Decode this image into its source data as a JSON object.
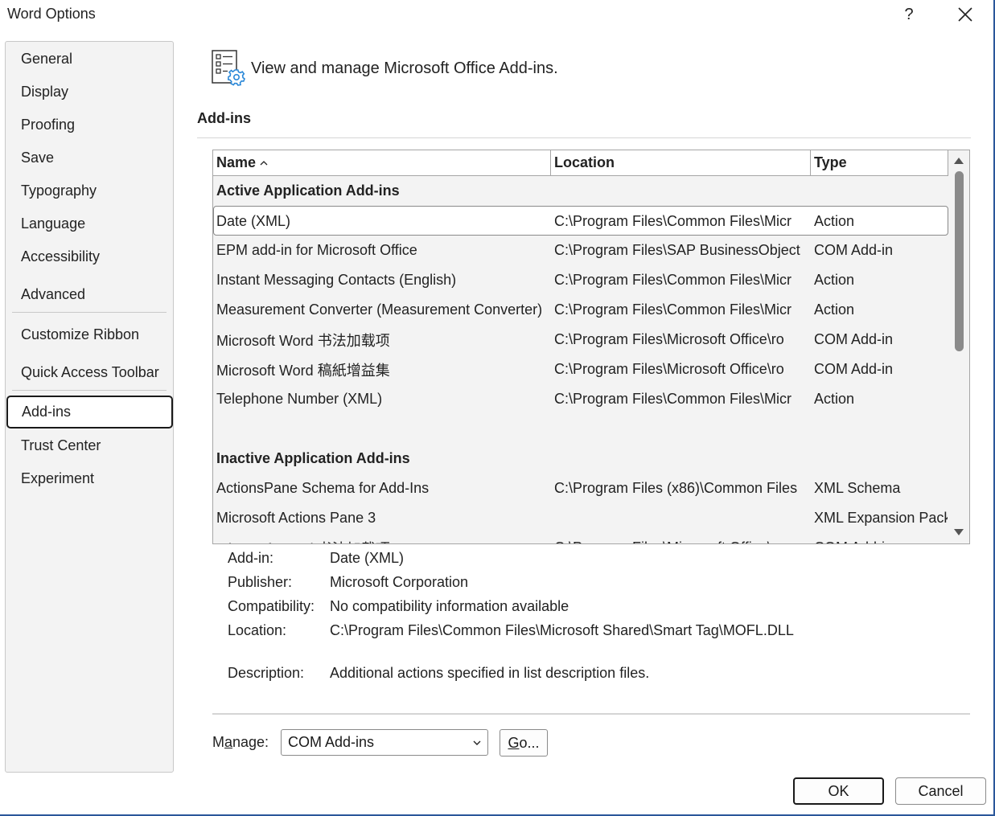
{
  "window": {
    "title": "Word Options",
    "help_label": "?",
    "close_icon": "close-icon"
  },
  "sidebar": {
    "items": [
      {
        "label": "General"
      },
      {
        "label": "Display"
      },
      {
        "label": "Proofing"
      },
      {
        "label": "Save"
      },
      {
        "label": "Typography"
      },
      {
        "label": "Language"
      },
      {
        "label": "Accessibility"
      },
      {
        "label": "Advanced"
      },
      {
        "label": "Customize Ribbon"
      },
      {
        "label": "Quick Access Toolbar"
      },
      {
        "label": "Add-ins",
        "selected": true
      },
      {
        "label": "Trust Center"
      },
      {
        "label": "Experiment"
      }
    ]
  },
  "header": {
    "icon": "addins-gear-icon",
    "text": "View and manage Microsoft Office Add-ins."
  },
  "addins": {
    "section_title": "Add-ins",
    "columns": {
      "name": "Name",
      "location": "Location",
      "type": "Type"
    },
    "sort_icon": "sort-ascending-icon",
    "active_group": "Active Application Add-ins",
    "active_rows": [
      {
        "name": "Date (XML)",
        "location": "C:\\Program Files\\Common Files\\Micr",
        "type": "Action",
        "selected": true
      },
      {
        "name": "EPM add-in for Microsoft Office",
        "location": "C:\\Program Files\\SAP BusinessObject",
        "type": "COM Add-in"
      },
      {
        "name": "Instant Messaging Contacts (English)",
        "location": "C:\\Program Files\\Common Files\\Micr",
        "type": "Action"
      },
      {
        "name": "Measurement Converter (Measurement Converter)",
        "location": "C:\\Program Files\\Common Files\\Micr",
        "type": "Action"
      },
      {
        "name": "Microsoft Word 书法加载项",
        "location": "C:\\Program Files\\Microsoft Office\\ro",
        "type": "COM Add-in"
      },
      {
        "name": "Microsoft Word 稿紙增益集",
        "location": "C:\\Program Files\\Microsoft Office\\ro",
        "type": "COM Add-in"
      },
      {
        "name": "Telephone Number (XML)",
        "location": "C:\\Program Files\\Common Files\\Micr",
        "type": "Action"
      }
    ],
    "inactive_group": "Inactive Application Add-ins",
    "inactive_rows": [
      {
        "name": "ActionsPane Schema for Add-Ins",
        "location": "C:\\Program Files (x86)\\Common Files",
        "type": "XML Schema"
      },
      {
        "name": "Microsoft Actions Pane 3",
        "location": "",
        "type": "XML Expansion Pack"
      },
      {
        "name": "Microsoft Word 书法加载项",
        "location": "C:\\Program Files\\Microsoft Office\\ro",
        "type": "COM Add-in"
      }
    ]
  },
  "details": {
    "addin_label": "Add-in:",
    "addin_value": "Date (XML)",
    "publisher_label": "Publisher:",
    "publisher_value": "Microsoft Corporation",
    "compat_label": "Compatibility:",
    "compat_value": "No compatibility information available",
    "location_label": "Location:",
    "location_value": "C:\\Program Files\\Common Files\\Microsoft Shared\\Smart Tag\\MOFL.DLL",
    "description_label": "Description:",
    "description_value": "Additional actions specified in list description files."
  },
  "manage": {
    "label_pre": "M",
    "label_mnemonic": "a",
    "label_post": "nage:",
    "selected": "COM Add-ins",
    "go_mnemonic": "G",
    "go_post": "o..."
  },
  "buttons": {
    "ok": "OK",
    "cancel": "Cancel"
  }
}
